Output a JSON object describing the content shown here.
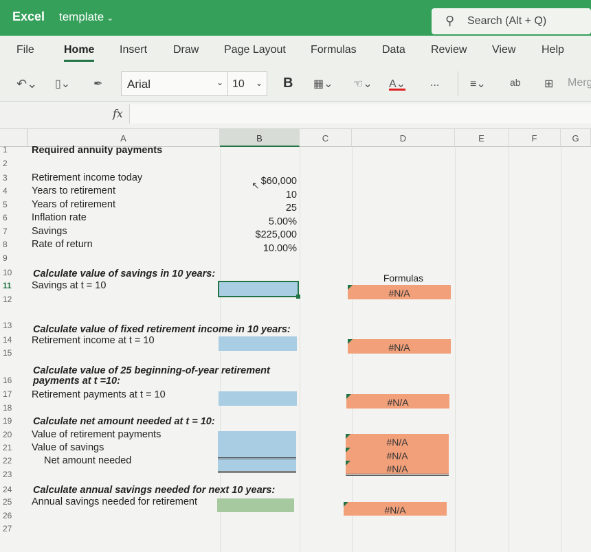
{
  "app": {
    "name": "Excel",
    "document": "template"
  },
  "search": {
    "placeholder": "Search (Alt + Q)"
  },
  "ribbon_tabs": [
    "File",
    "Home",
    "Insert",
    "Draw",
    "Page Layout",
    "Formulas",
    "Data",
    "Review",
    "View",
    "Help"
  ],
  "active_tab": "Home",
  "toolbar": {
    "font": "Arial",
    "size": "10",
    "bold": "B",
    "more": "...",
    "merge": "Merg",
    "wrap": "ab"
  },
  "formula_bar": {
    "fx": "fx",
    "value": ""
  },
  "columns": [
    "A",
    "B",
    "C",
    "D",
    "E",
    "F",
    "G"
  ],
  "rows": [
    "1",
    "2",
    "3",
    "4",
    "5",
    "6",
    "7",
    "8",
    "9",
    "10",
    "11",
    "12",
    "13",
    "14",
    "15",
    "16",
    "17",
    "18",
    "19",
    "20",
    "21",
    "22",
    "23",
    "24",
    "25",
    "26",
    "27"
  ],
  "sheet": {
    "title": "Required annuity payments",
    "inputs": [
      {
        "label": "Retirement income today",
        "value": "$60,000"
      },
      {
        "label": "Years to retirement",
        "value": "10"
      },
      {
        "label": "Years of retirement",
        "value": "25"
      },
      {
        "label": "Inflation rate",
        "value": "5.00%"
      },
      {
        "label": "Savings",
        "value": "$225,000"
      },
      {
        "label": "Rate of return",
        "value": "10.00%"
      }
    ],
    "sec1": {
      "heading": "Calculate value of savings in 10 years:",
      "label": "Savings at t = 10"
    },
    "formulas_header": "Formulas",
    "sec2": {
      "heading": "Calculate value of fixed retirement income in 10 years:",
      "label": "Retirement income at t = 10"
    },
    "sec3": {
      "heading_line1": "Calculate value of 25 beginning-of-year retirement",
      "heading_line2": "payments at t =10:",
      "label": "Retirement payments at t = 10"
    },
    "sec4": {
      "heading": "Calculate net amount needed at t = 10:",
      "label1": "Value of retirement payments",
      "label2": "Value of savings",
      "label3": "Net amount needed"
    },
    "sec5": {
      "heading": "Calculate annual savings needed for next 10 years:",
      "label": "Annual savings needed for retirement"
    },
    "na": "#N/A"
  },
  "colors": {
    "excel_green": "#35a05a",
    "input_blue": "#a9cde3",
    "formula_orange": "#f2a07a",
    "answer_green": "#a6c9a0"
  }
}
